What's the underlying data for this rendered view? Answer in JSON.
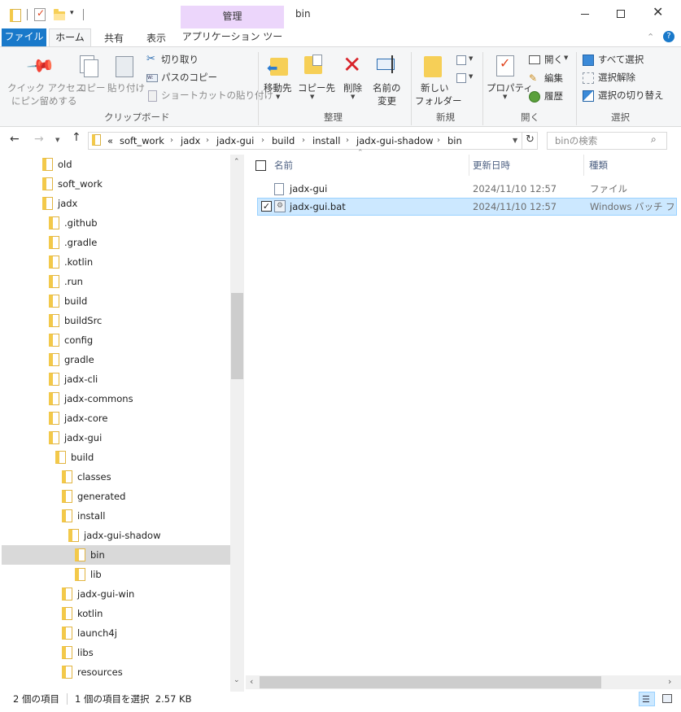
{
  "window": {
    "contextual_tab_group": "管理",
    "title": "bin",
    "controls": [
      "minimize-icon",
      "maximize-icon",
      "close-icon"
    ]
  },
  "tabs": [
    {
      "label": "ファイル",
      "active": false,
      "file": true
    },
    {
      "label": "ホーム",
      "active": true
    },
    {
      "label": "共有",
      "active": false
    },
    {
      "label": "表示",
      "active": false
    },
    {
      "label": "アプリケーション ツール",
      "active": false
    }
  ],
  "ribbon": {
    "clipboard": {
      "pin_label_1": "クイック アクセス",
      "pin_label_2": "にピン留めする",
      "copy": "コピー",
      "paste": "貼り付け",
      "cut": "切り取り",
      "copy_path": "パスのコピー",
      "paste_shortcut": "ショートカットの貼り付け",
      "group": "クリップボード"
    },
    "organize": {
      "move_to": "移動先",
      "copy_to": "コピー先",
      "delete": "削除",
      "rename_1": "名前の",
      "rename_2": "変更",
      "group": "整理"
    },
    "new": {
      "new_folder_1": "新しい",
      "new_folder_2": "フォルダー",
      "group": "新規"
    },
    "open": {
      "properties": "プロパティ",
      "open": "開く",
      "edit": "編集",
      "history": "履歴",
      "group": "開く"
    },
    "select": {
      "select_all": "すべて選択",
      "select_none": "選択解除",
      "invert": "選択の切り替え",
      "group": "選択"
    }
  },
  "address": {
    "overflow": "«",
    "crumbs": [
      "soft_work",
      "jadx",
      "jadx-gui",
      "build",
      "install",
      "jadx-gui-shadow",
      "bin"
    ],
    "search_placeholder": "binの検索"
  },
  "tree": [
    {
      "label": "old",
      "indent": 0
    },
    {
      "label": "soft_work",
      "indent": 0
    },
    {
      "label": "jadx",
      "indent": 1
    },
    {
      "label": ".github",
      "indent": 2
    },
    {
      "label": ".gradle",
      "indent": 2
    },
    {
      "label": ".kotlin",
      "indent": 2
    },
    {
      "label": ".run",
      "indent": 2
    },
    {
      "label": "build",
      "indent": 2
    },
    {
      "label": "buildSrc",
      "indent": 2
    },
    {
      "label": "config",
      "indent": 2
    },
    {
      "label": "gradle",
      "indent": 2
    },
    {
      "label": "jadx-cli",
      "indent": 2
    },
    {
      "label": "jadx-commons",
      "indent": 2
    },
    {
      "label": "jadx-core",
      "indent": 2
    },
    {
      "label": "jadx-gui",
      "indent": 2
    },
    {
      "label": "build",
      "indent": 3
    },
    {
      "label": "classes",
      "indent": 4
    },
    {
      "label": "generated",
      "indent": 4
    },
    {
      "label": "install",
      "indent": 4
    },
    {
      "label": "jadx-gui-shadow",
      "indent": 5
    },
    {
      "label": "bin",
      "indent": 6,
      "selected": true
    },
    {
      "label": "lib",
      "indent": 6
    },
    {
      "label": "jadx-gui-win",
      "indent": 4
    },
    {
      "label": "kotlin",
      "indent": 4
    },
    {
      "label": "launch4j",
      "indent": 4
    },
    {
      "label": "libs",
      "indent": 4
    },
    {
      "label": "resources",
      "indent": 4
    }
  ],
  "columns": {
    "name": "名前",
    "date": "更新日時",
    "type": "種類"
  },
  "files": [
    {
      "name": "jadx-gui",
      "date": "2024/11/10 12:57",
      "type": "ファイル",
      "selected": false
    },
    {
      "name": "jadx-gui.bat",
      "date": "2024/11/10 12:57",
      "type": "Windows バッチ ファ...",
      "selected": true
    }
  ],
  "status": {
    "count": "2 個の項目",
    "selection": "1 個の項目を選択  2.57 KB"
  },
  "colors": {
    "file_tab": "#1979ca",
    "contextual": "#ecd6fb",
    "selected_row": "#cce8ff",
    "selected_border": "#99d1ff",
    "tree_selected": "#d9d9d9"
  }
}
